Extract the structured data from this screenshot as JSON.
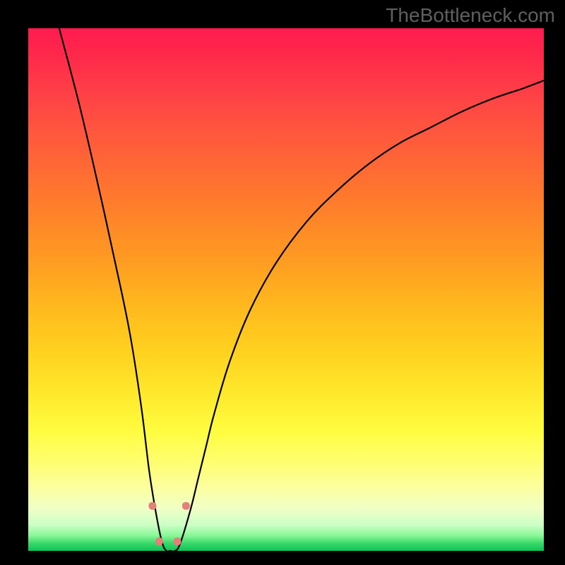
{
  "watermark": "TheBottleneck.com",
  "chart_data": {
    "type": "line",
    "title": "",
    "xlabel": "",
    "ylabel": "",
    "xlim": [
      0,
      100
    ],
    "ylim": [
      0,
      100
    ],
    "grid": false,
    "legend": false,
    "annotations": [],
    "series": [
      {
        "name": "bottleneck-curve",
        "x": [
          6,
          10,
          14,
          18,
          20,
          22,
          23.5,
          25,
          26,
          26.8,
          27.5,
          28.5,
          29.5,
          31.5,
          33,
          34.5,
          36,
          39,
          43,
          48,
          54,
          60,
          66,
          72,
          78,
          84,
          90,
          96,
          100
        ],
        "y": [
          100,
          85,
          68,
          50,
          40,
          27,
          15,
          6,
          1.5,
          0,
          0,
          0,
          1.5,
          8,
          14,
          20,
          26,
          36,
          46,
          55,
          63,
          69,
          74,
          78,
          81,
          84,
          86.5,
          88.5,
          90
        ]
      }
    ],
    "markers": [
      {
        "x": 24.1,
        "y": 8.6,
        "color": "#e28178",
        "size": 11
      },
      {
        "x": 25.4,
        "y": 1.8,
        "color": "#e28178",
        "size": 11
      },
      {
        "x": 28.9,
        "y": 1.8,
        "color": "#e28178",
        "size": 11
      },
      {
        "x": 30.6,
        "y": 8.6,
        "color": "#e28178",
        "size": 11
      }
    ],
    "background": {
      "type": "vertical-gradient",
      "stops": [
        {
          "pos": 0.0,
          "color": "#ff1b4f"
        },
        {
          "pos": 0.5,
          "color": "#ffb81e"
        },
        {
          "pos": 0.8,
          "color": "#fffc40"
        },
        {
          "pos": 1.0,
          "color": "#0cc257"
        }
      ]
    }
  }
}
